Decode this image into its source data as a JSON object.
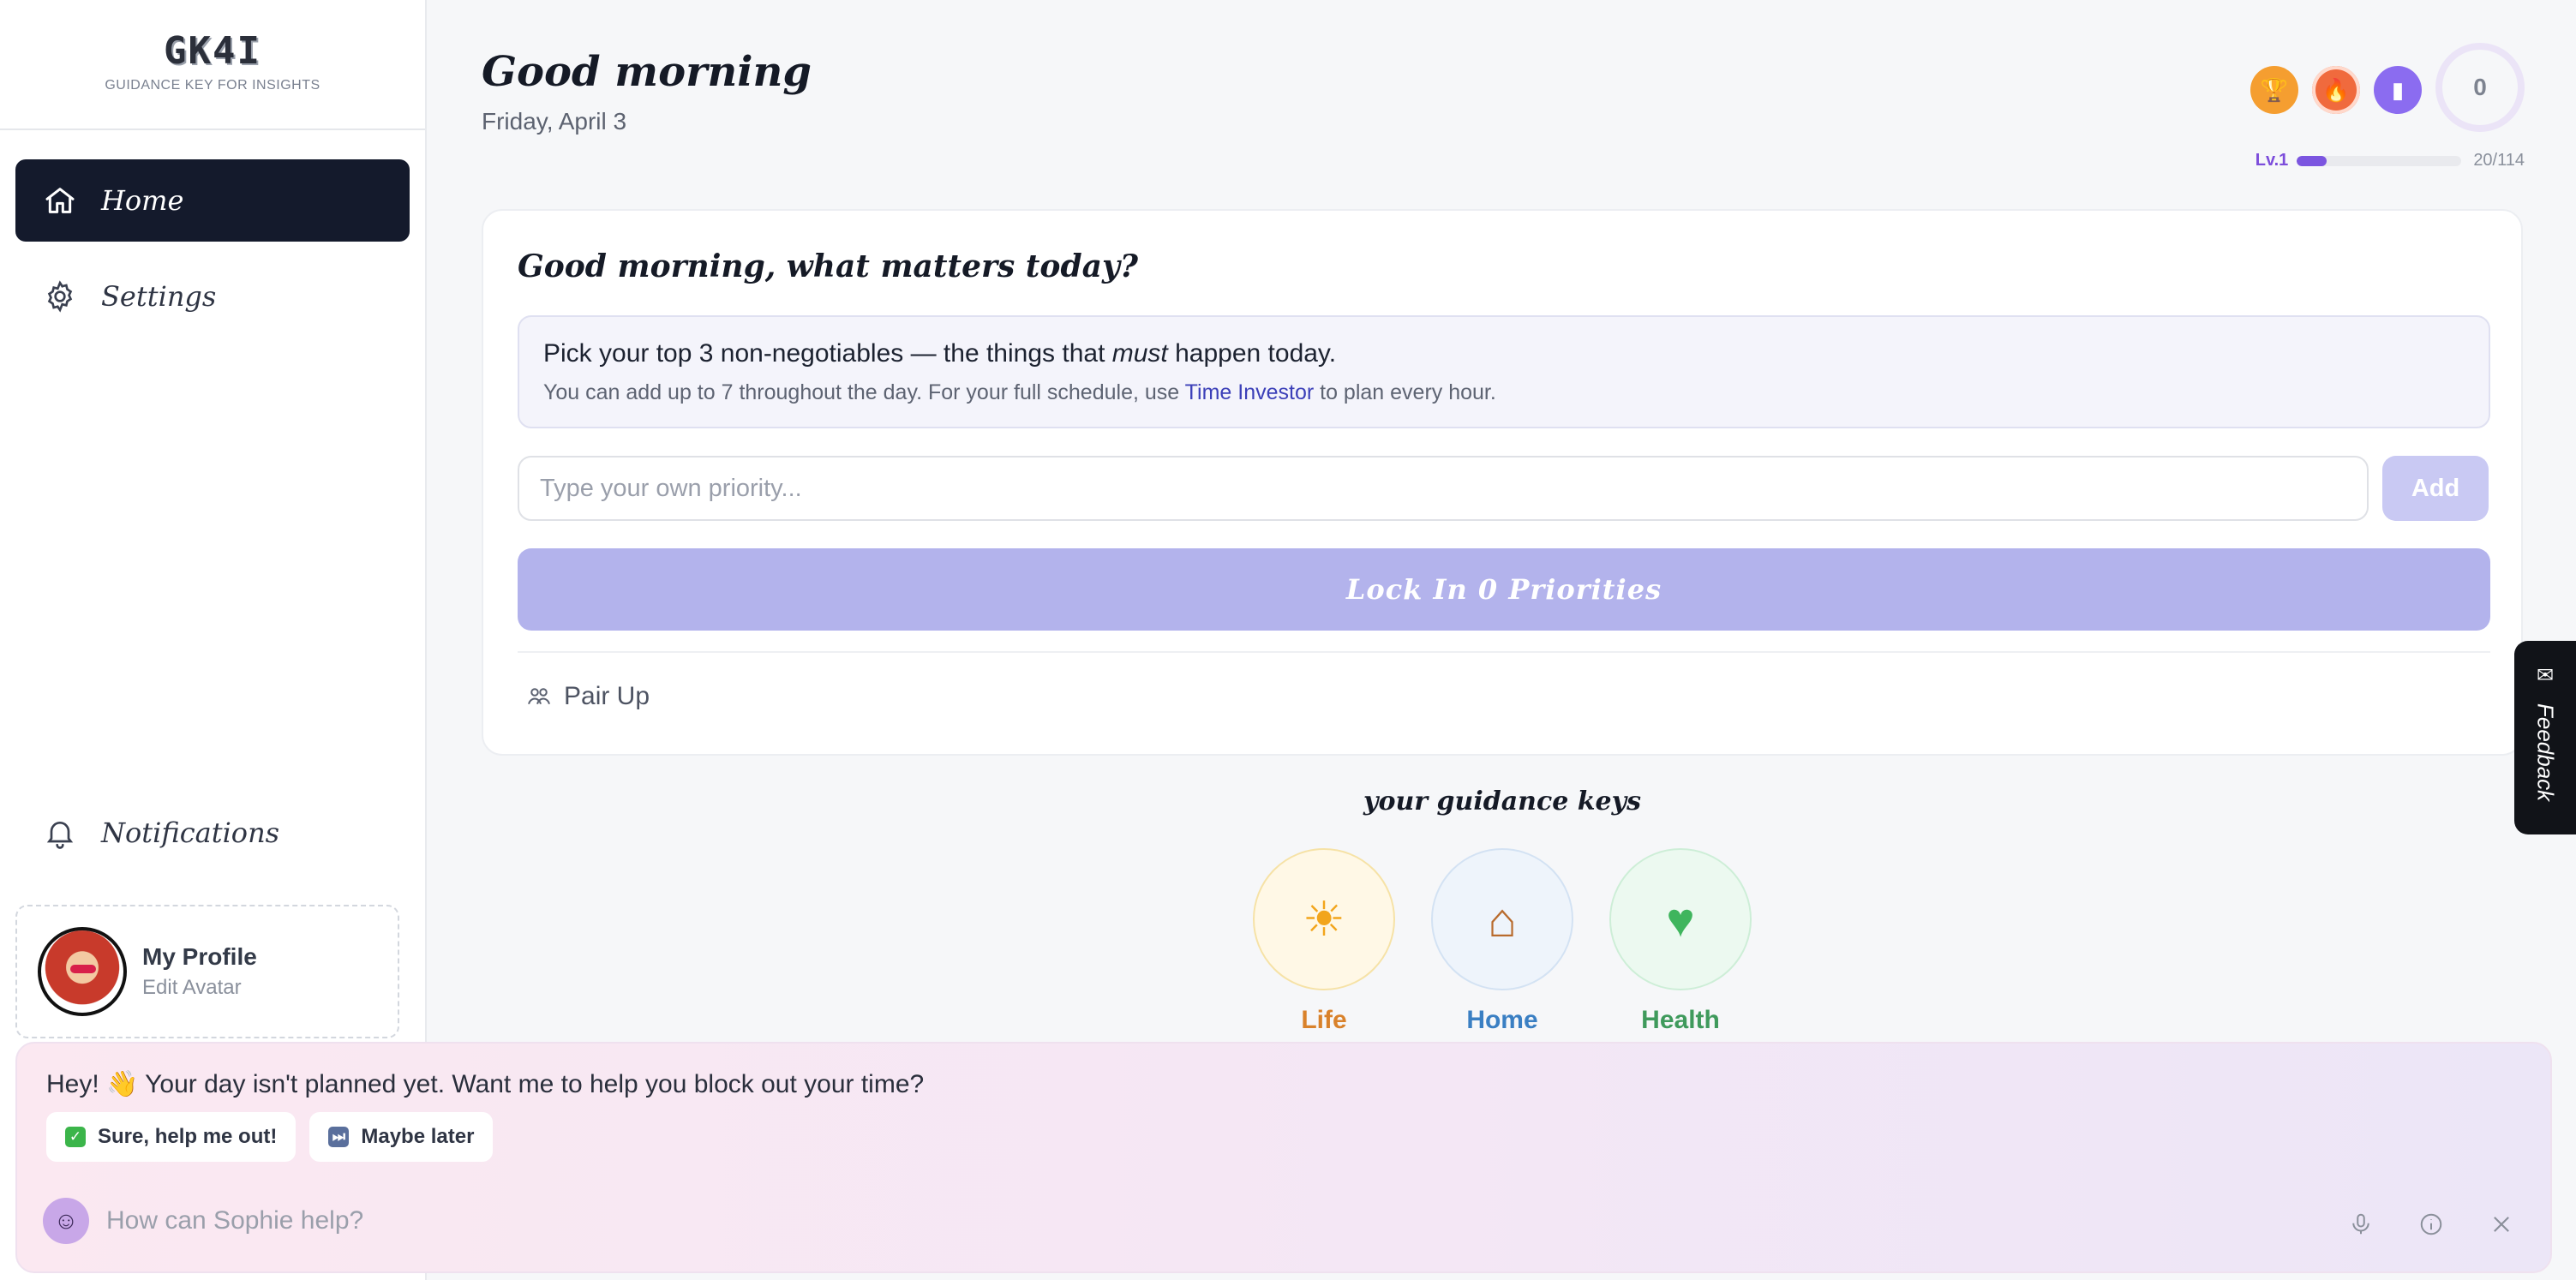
{
  "brand": {
    "logo": "GK4I",
    "subtitle": "GUIDANCE KEY FOR INSIGHTS"
  },
  "sidebar": {
    "items": [
      {
        "label": "Home",
        "icon": "home-icon",
        "active": true
      },
      {
        "label": "Settings",
        "icon": "gear-icon",
        "active": false
      }
    ],
    "notifications_label": "Notifications",
    "profile": {
      "name": "My Profile",
      "sub": "Edit Avatar"
    }
  },
  "header": {
    "title": "Good morning",
    "date": "Friday, April 3",
    "ring_value": "0",
    "level_label": "Lv.1",
    "level_progress_text": "20/114",
    "level_progress_fraction": 0.18
  },
  "card": {
    "title": "Good morning, what matters today?",
    "info_prefix": "Pick your top 3 non-negotiables — the things that ",
    "info_emphasis": "must",
    "info_suffix": " happen today.",
    "info_sub_prefix": "You can add up to 7 throughout the day. For your full schedule, use ",
    "info_link": "Time Investor",
    "info_sub_suffix": " to plan every hour.",
    "input_placeholder": "Type your own priority...",
    "add_label": "Add",
    "lock_label": "Lock In 0 Priorities",
    "pair_up_label": "Pair Up"
  },
  "keys": {
    "title": "your guidance keys",
    "items": [
      {
        "label": "Life",
        "glyph": "☀"
      },
      {
        "label": "Home",
        "glyph": "⌂"
      },
      {
        "label": "Health",
        "glyph": "♥"
      }
    ]
  },
  "feedback": {
    "label": "Feedback"
  },
  "assistant": {
    "message": "Hey! 👋 Your day isn't planned yet. Want me to help you block out your time?",
    "chip_yes": "Sure, help me out!",
    "chip_later": "Maybe later",
    "input_placeholder": "How can Sophie help?"
  },
  "colors": {
    "accent": "#7b55e0",
    "active_nav": "#141a2c",
    "lock_button": "#b3b3ec"
  }
}
